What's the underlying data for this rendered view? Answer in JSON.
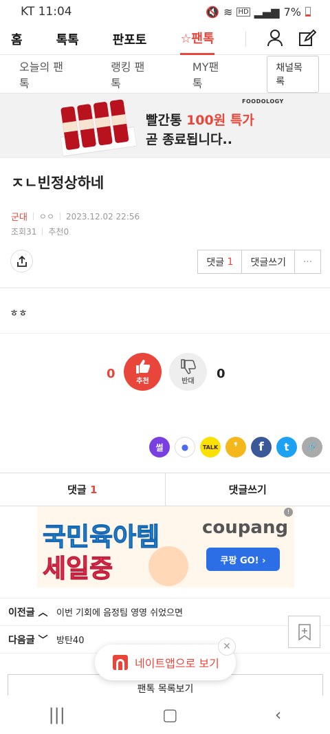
{
  "status": {
    "carrier_time": "KT 11:04",
    "icons_text": "HD",
    "battery": "7%"
  },
  "nav": {
    "tabs": [
      "홈",
      "톡톡",
      "판포토",
      "☆팬톡"
    ]
  },
  "subnav": {
    "items": [
      "오늘의 팬톡",
      "랭킹 팬톡",
      "MY팬톡"
    ],
    "channel_button": "채널목록"
  },
  "ad_top": {
    "brand": "FOODOLOGY",
    "line1_pre": "빨간통 ",
    "line1_red": "100원 특가",
    "line2": "곧 종료됩니다.."
  },
  "post": {
    "title": "ㅈㄴ빈정상하네",
    "nick": "군대",
    "icon": "ㅇㅇ",
    "date": "2023.12.02 22:56",
    "views": "조회31",
    "recommend": "추천0",
    "body": "ㅎㅎ"
  },
  "tools": {
    "comment_label": "댓글",
    "comment_count": "1",
    "write_label": "댓글쓰기",
    "more": "···"
  },
  "vote": {
    "up_count": "0",
    "up_label": "추천",
    "down_label": "반대",
    "down_count": "0"
  },
  "social": {
    "items": [
      "썰",
      "●",
      "TALK",
      "❜",
      "f",
      "t",
      "🔗"
    ],
    "colors": [
      "#7a3fe0",
      "#fff",
      "#fae100",
      "#f5b81c",
      "#3b5998",
      "#1da1f2",
      "#aaaaaa"
    ]
  },
  "comment_bar": {
    "comment_label": "댓글",
    "comment_count": "1",
    "write_label": "댓글쓰기"
  },
  "ad_mid": {
    "line1": "국민육아템",
    "line2": "세일중",
    "brand": "coupang",
    "button": "쿠팡 GO! ›",
    "info": "!"
  },
  "prev": {
    "label": "이전글 ︿",
    "title": "이번 기회에 음정팀 영영 쉬었으면"
  },
  "next": {
    "label": "다음글 ﹀",
    "title": "방탄40"
  },
  "list_button": "팬톡 목록보기",
  "app_pill": "네이트앱으로 보기"
}
